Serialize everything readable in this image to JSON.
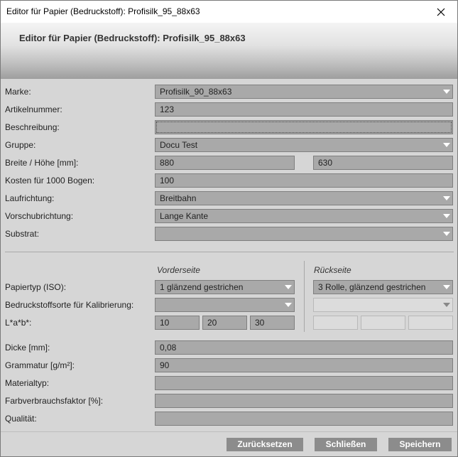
{
  "window": {
    "title": "Editor für Papier (Bedruckstoff): Profisilk_95_88x63"
  },
  "header": {
    "title": "Editor für Papier (Bedruckstoff): Profisilk_95_88x63"
  },
  "form": {
    "marke": {
      "label": "Marke:",
      "value": "Profisilk_90_88x63"
    },
    "artikelnummer": {
      "label": "Artikelnummer:",
      "value": "123"
    },
    "beschreibung": {
      "label": "Beschreibung:",
      "value": ""
    },
    "gruppe": {
      "label": "Gruppe:",
      "value": "Docu Test"
    },
    "breite_hoehe": {
      "label": "Breite / Höhe [mm]:",
      "breite": "880",
      "hoehe": "630"
    },
    "kosten": {
      "label": "Kosten für 1000 Bogen:",
      "value": "100"
    },
    "laufrichtung": {
      "label": "Laufrichtung:",
      "value": "Breitbahn"
    },
    "vorschubrichtung": {
      "label": "Vorschubrichtung:",
      "value": "Lange Kante"
    },
    "substrat": {
      "label": "Substrat:",
      "value": ""
    },
    "columns": {
      "front": "Vorderseite",
      "back": "Rückseite"
    },
    "papiertyp": {
      "label": "Papiertyp (ISO):",
      "front": "1 glänzend gestrichen",
      "back": "3 Rolle, glänzend gestrichen"
    },
    "bedruckstoffsorte": {
      "label": "Bedruckstoffsorte für Kalibrierung:",
      "front": "",
      "back": ""
    },
    "lab": {
      "label": "L*a*b*:",
      "front_l": "10",
      "front_a": "20",
      "front_b": "30",
      "back_l": "",
      "back_a": "",
      "back_b": ""
    },
    "dicke": {
      "label": "Dicke [mm]:",
      "value": "0,08"
    },
    "grammatur": {
      "label": "Grammatur [g/m²]:",
      "value": "90"
    },
    "materialtyp": {
      "label": "Materialtyp:",
      "value": ""
    },
    "farbverbrauch": {
      "label": "Farbverbrauchsfaktor [%]:",
      "value": ""
    },
    "qualitaet": {
      "label": "Qualität:",
      "value": ""
    }
  },
  "buttons": {
    "reset": "Zurücksetzen",
    "close": "Schließen",
    "save": "Speichern"
  },
  "icons": {
    "close": "close-icon",
    "dropdown": "chevron-down-icon"
  },
  "colors": {
    "field_bg": "#a9a9a9",
    "button_bg": "#8c8c8c",
    "panel_bg": "#d6d6d6"
  }
}
